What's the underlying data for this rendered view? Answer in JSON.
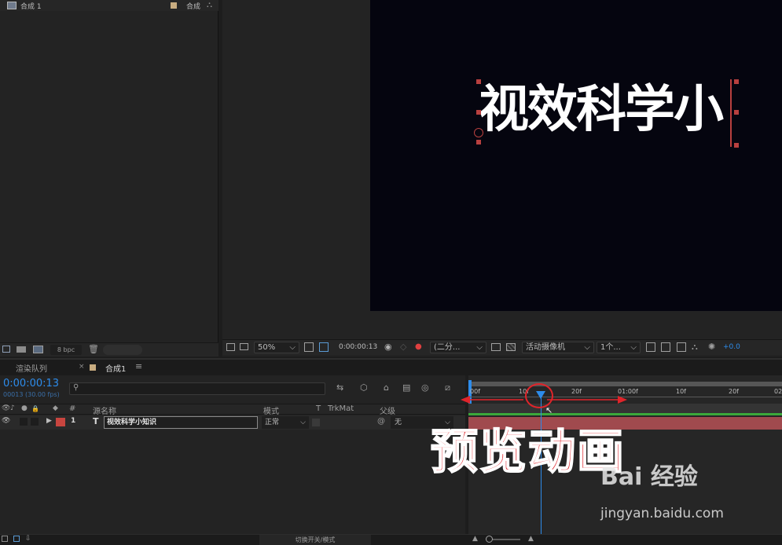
{
  "project": {
    "comp_item": "合成 1",
    "folder_label": "合成",
    "bpc": "8 bpc"
  },
  "viewer": {
    "zoom": "50%",
    "timecode": "0:00:00:13",
    "resolution": "(二分...",
    "camera": "活动摄像机",
    "views": "1个...",
    "exposure": "+0.0",
    "canvas_text": "视效科学小",
    "colors": {
      "canvas": "#05050f",
      "text": "#ffffff",
      "accent": "#2d8ceb",
      "handle": "#b8403f"
    }
  },
  "timeline": {
    "tabs": {
      "render_queue": "渲染队列",
      "comp": "合成1"
    },
    "current_time": "0:00:00:13",
    "fps_info": "00013 (30.00 fps)",
    "columns": {
      "num": "#",
      "source_name": "源名称",
      "mode": "模式",
      "t": "T",
      "trkmat": "TrkMat",
      "parent": "父级"
    },
    "layers": [
      {
        "index": "1",
        "type": "T",
        "name": "视效科学小知识",
        "mode": "正常",
        "parent": "无",
        "color": "#c8453f"
      }
    ],
    "ruler": [
      "00f",
      "10f",
      "20f",
      "01:00f",
      "10f",
      "20f",
      "02"
    ],
    "annotation": "预览动画",
    "footer_label": "切换开关/模式",
    "colors": {
      "layer_bar": "#a04a4e",
      "work_area": "#3ba83b",
      "playhead": "#2d8ceb",
      "annotation": "#e0242a"
    }
  },
  "watermark": {
    "brand": "Bai 经验",
    "url": "jingyan.baidu.com"
  }
}
